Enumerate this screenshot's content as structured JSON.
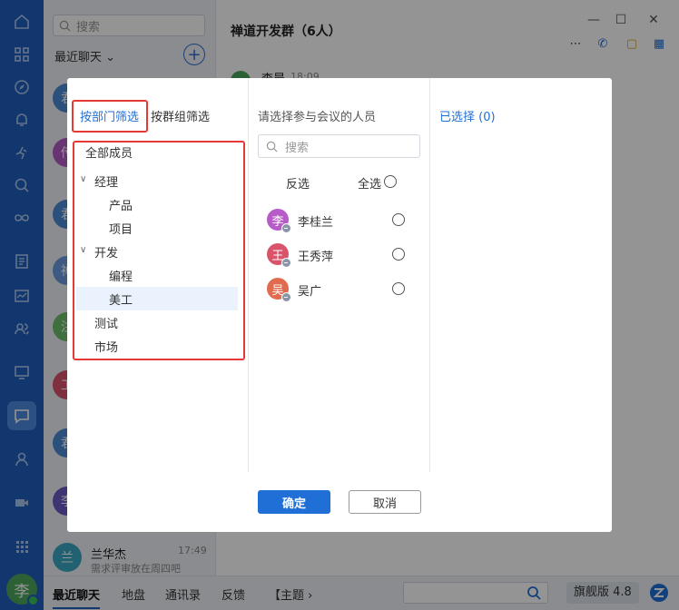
{
  "sidebar": {
    "search_placeholder": "搜索",
    "recent_label": "最近聊天",
    "conversations": [
      {
        "avatar": "君",
        "color": "#4a8ad6"
      },
      {
        "avatar": "传",
        "color": "#b65bc7"
      },
      {
        "avatar": "君",
        "color": "#4a8ad6"
      },
      {
        "avatar": "禅",
        "color": "#6b9be0"
      },
      {
        "avatar": "注",
        "color": "#6cbf6a"
      },
      {
        "avatar": "工",
        "color": "#d9536b"
      },
      {
        "avatar": "君",
        "color": "#4a8ad6"
      },
      {
        "avatar": "李",
        "color": "#6b5bc7"
      },
      {
        "avatar": "兰",
        "color": "#3aa7c4"
      }
    ],
    "last_conversation": {
      "name": "兰华杰",
      "time": "17:49",
      "preview": "需求评审放在周四吧"
    },
    "user_avatar": "李"
  },
  "chat": {
    "title": "禅道开发群（6人）",
    "sender_name": "李晨",
    "sender_time": "18:09"
  },
  "bottom": {
    "tabs": [
      "最近聊天",
      "地盘",
      "通讯录",
      "反馈",
      "【主题 ›"
    ],
    "version": "旗舰版 4.8"
  },
  "dialog": {
    "tab_department": "按部门筛选",
    "tab_group": "按群组筛选",
    "tree": {
      "all": "全部成员",
      "manager": "经理",
      "product": "产品",
      "project": "项目",
      "dev": "开发",
      "coding": "编程",
      "art": "美工",
      "test": "测试",
      "market": "市场"
    },
    "mid_title": "请选择参与会议的人员",
    "mid_search_placeholder": "搜索",
    "invert_label": "反选",
    "select_all_label": "全选",
    "people": [
      {
        "avatar": "李",
        "name": "李桂兰",
        "color": "#b65bc7"
      },
      {
        "avatar": "王",
        "name": "王秀萍",
        "color": "#d9536b"
      },
      {
        "avatar": "吴",
        "name": "吴广",
        "color": "#e06b4f"
      }
    ],
    "selected_label": "已选择 (0)",
    "ok_label": "确定",
    "cancel_label": "取消"
  }
}
